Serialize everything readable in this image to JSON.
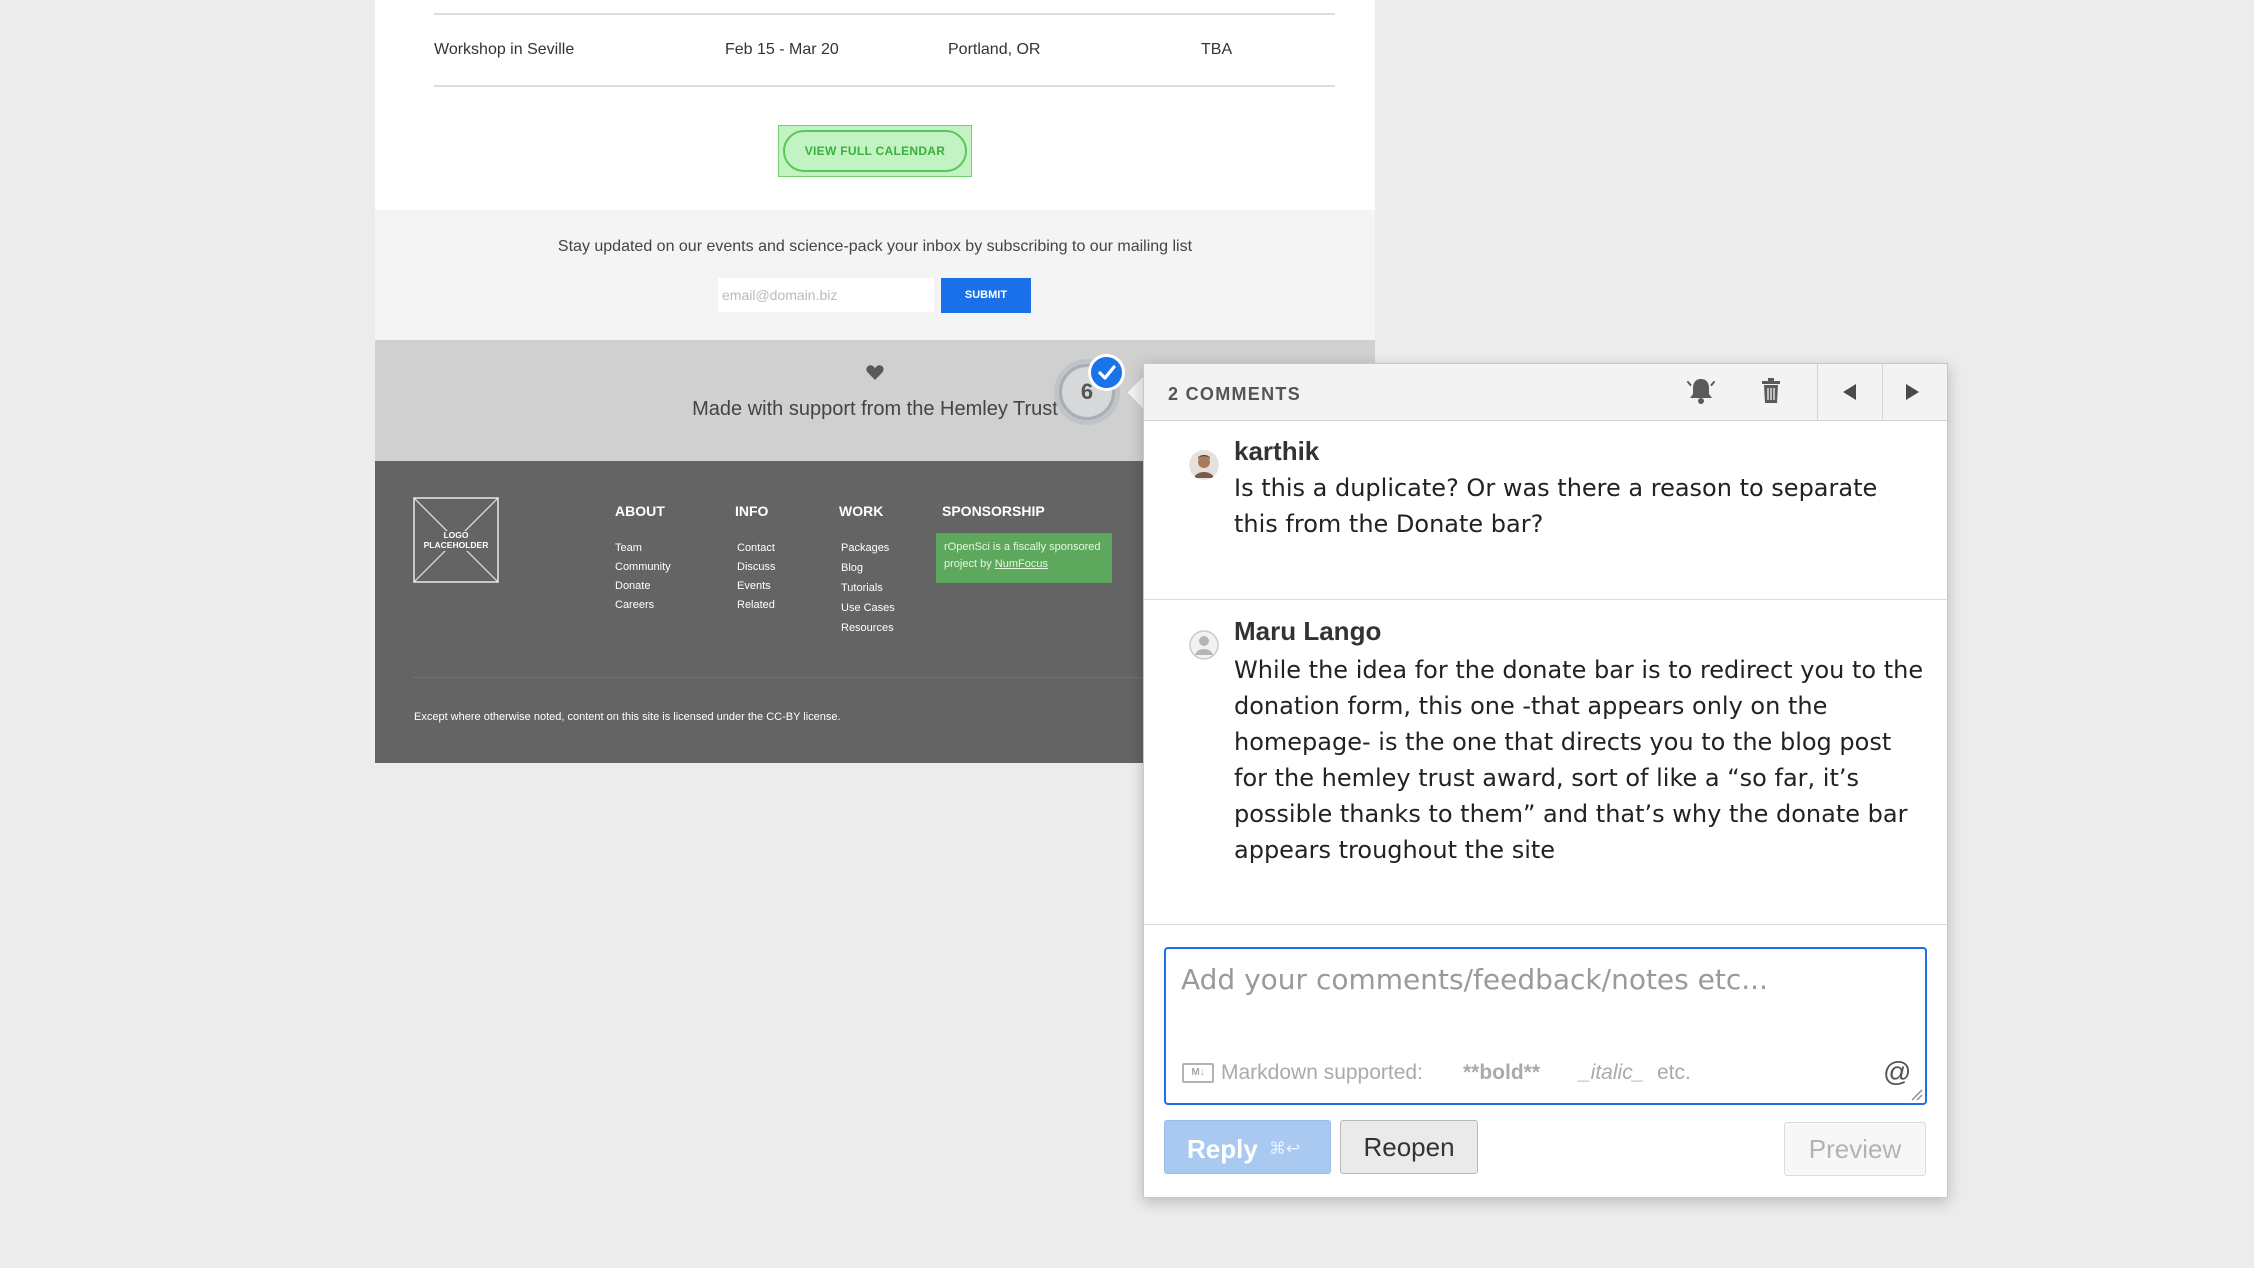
{
  "events": {
    "row": {
      "name": "Workshop in Seville",
      "dates": "Feb 15 - Mar 20",
      "location": "Portland, OR",
      "status": "TBA"
    },
    "view_calendar_label": "VIEW FULL CALENDAR"
  },
  "newsletter": {
    "text": "Stay updated on our events and science-pack your inbox by subscribing to our mailing list",
    "email_placeholder": "email@domain.biz",
    "submit_label": "SUBMIT"
  },
  "support": {
    "icon": "heart-icon",
    "text": "Made with support from the Hemley Trust"
  },
  "footer": {
    "logo_text": "LOGO PLACEHOLDER",
    "columns": [
      {
        "heading": "ABOUT",
        "links": [
          "Team",
          "Community",
          "Donate",
          "Careers"
        ]
      },
      {
        "heading": "INFO",
        "links": [
          "Contact",
          "Discuss",
          "Events",
          "Related"
        ]
      },
      {
        "heading": "WORK",
        "links": [
          "Packages",
          "Blog",
          "Tutorials",
          "Use Cases",
          "Resources"
        ]
      },
      {
        "heading": "SPONSORSHIP",
        "text": "rOpenSci is a fiscally sponsored project by",
        "link": "NumFocus"
      }
    ],
    "license": "Except where otherwise noted, content on this site is licensed under the CC-BY license."
  },
  "pin": {
    "number": "6",
    "resolved": true
  },
  "comments_panel": {
    "count_label": "2 COMMENTS",
    "header_icons": [
      "bell-icon",
      "trash-icon",
      "prev-arrow-icon",
      "next-arrow-icon"
    ],
    "comments": [
      {
        "author": "karthik",
        "body": "Is this a duplicate? Or was there a reason to separate this from the Donate bar?"
      },
      {
        "author": "Maru Lango",
        "body": "While the idea for the donate bar is to redirect you to the donation form, this one -that appears only on the homepage- is the one that directs you to the blog post for the hemley trust award, sort of like a “so far, it’s possible thanks to them” and that’s why the donate bar appears troughout the site"
      }
    ],
    "editor": {
      "placeholder": "Add your comments/feedback/notes etc...",
      "markdown_badge": "M↓",
      "markdown_label": "Markdown supported:",
      "markdown_bold": "**bold**",
      "markdown_italic": "_italic_",
      "markdown_etc": "etc.",
      "mention_symbol": "@"
    },
    "reply_label": "Reply",
    "reply_shortcut": "⌘↩",
    "reopen_label": "Reopen",
    "preview_label": "Preview"
  },
  "colors": {
    "accent": "#1a70e8",
    "calendar_green": "#59c859",
    "footer_bg": "#646464",
    "sponsor_green": "#5ea85e"
  }
}
